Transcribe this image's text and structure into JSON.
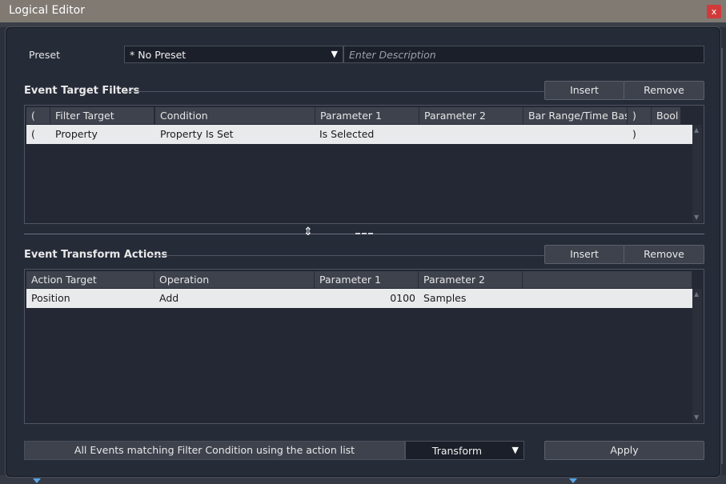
{
  "window": {
    "title": "Logical Editor",
    "close_glyph": "x"
  },
  "preset": {
    "label": "Preset",
    "value": "* No Preset",
    "description_placeholder": "Enter Description"
  },
  "filters": {
    "section_label": "Event Target Filters",
    "insert_label": "Insert",
    "remove_label": "Remove",
    "columns": [
      "(",
      "Filter Target",
      "Condition",
      "Parameter 1",
      "Parameter 2",
      "Bar Range/Time Base",
      ")",
      "Bool"
    ],
    "rows": [
      {
        "open": "(",
        "target": "Property",
        "condition": "Property Is Set",
        "param1": "Is Selected",
        "param2": "",
        "bar_range": "",
        "close": ")",
        "bool": ""
      }
    ]
  },
  "actions": {
    "section_label": "Event Transform Actions",
    "insert_label": "Insert",
    "remove_label": "Remove",
    "columns": [
      "Action Target",
      "Operation",
      "Parameter 1",
      "Parameter 2"
    ],
    "rows": [
      {
        "target": "Position",
        "operation": "Add",
        "param1": "0100",
        "param2": "Samples"
      }
    ]
  },
  "footer": {
    "description": "All Events matching Filter Condition using the action list",
    "mode_value": "Transform",
    "apply_label": "Apply"
  },
  "icons": {
    "dropdown": "chevron-down-icon",
    "close": "close-icon",
    "splitter": "resize-vertical-icon"
  }
}
